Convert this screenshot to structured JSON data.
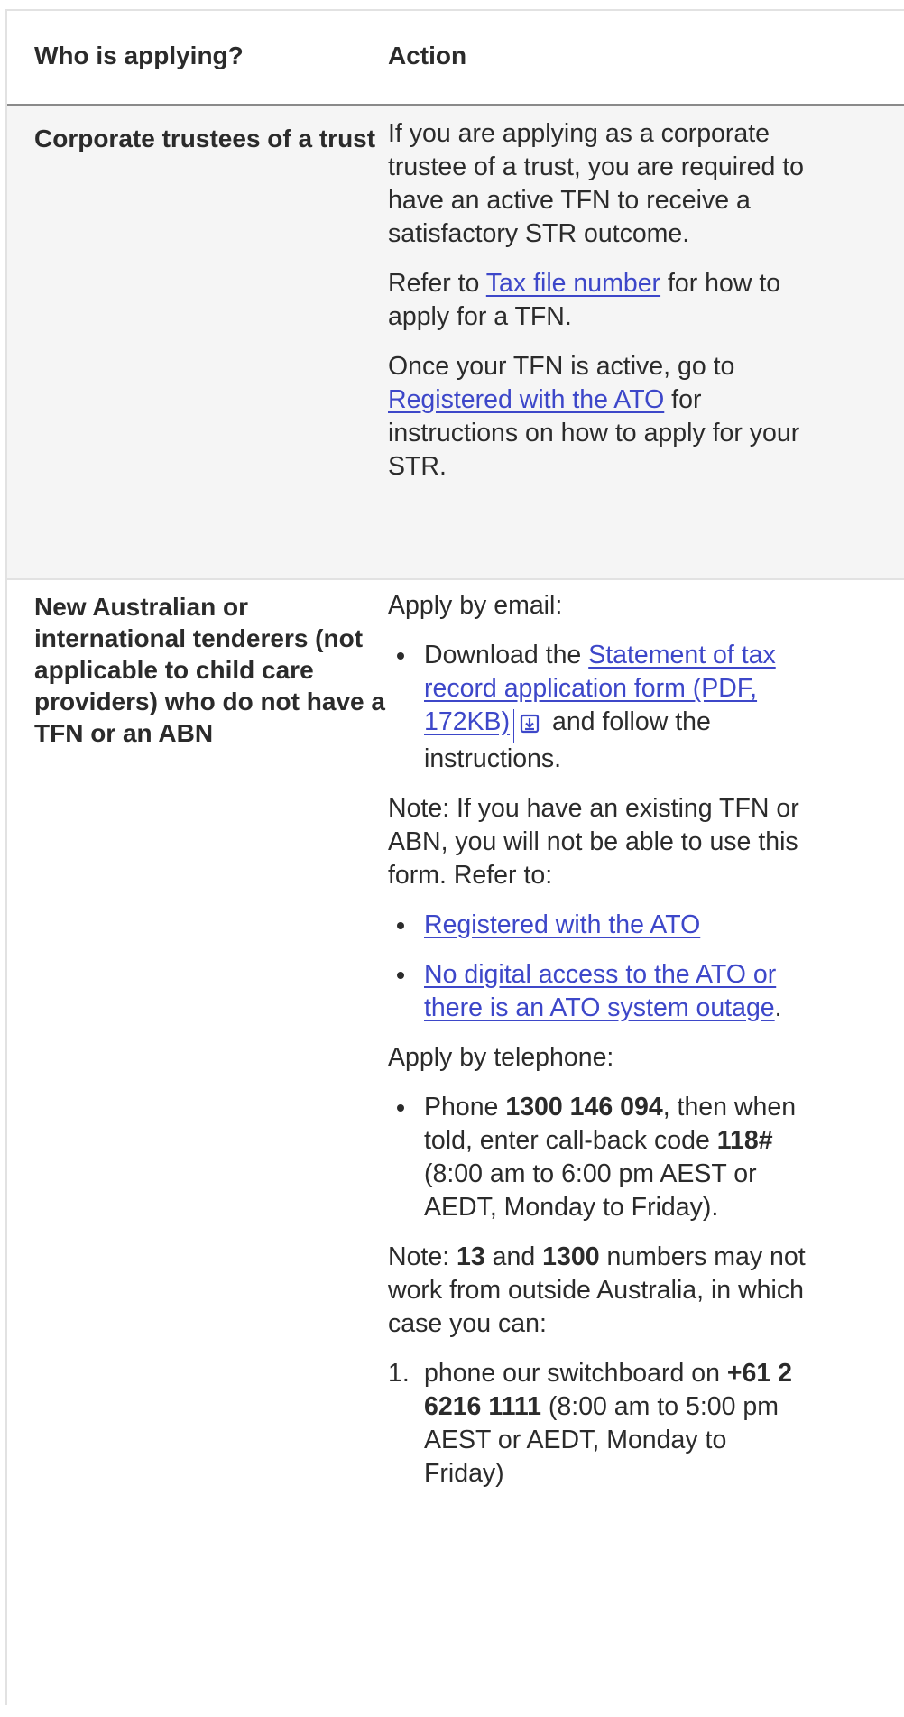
{
  "table": {
    "header": {
      "col1": "Who is applying?",
      "col2": "Action"
    },
    "row1": {
      "who": "Corporate trustees of a trust",
      "p1": "If you are applying as a corporate trustee of a trust, you are required to have an active TFN to receive a satisfactory STR outcome.",
      "p2_prefix": "Refer to ",
      "p2_link": "Tax file number",
      "p2_suffix": " for how to apply for a TFN.",
      "p3_prefix": "Once your TFN is active, go to ",
      "p3_link": "Registered with the ATO",
      "p3_suffix": " for instructions on how to apply for your STR."
    },
    "row2": {
      "who": "New Australian or international tenderers (not applicable to child care providers) who do not have a TFN or an ABN",
      "email_heading": "Apply by email:",
      "download_prefix": "Download the ",
      "download_link": "Statement of tax record application form (PDF, 172KB)",
      "download_suffix": " and follow the instructions.",
      "note1": "Note: If you have an existing TFN or ABN, you will not be able to use this form. Refer to:",
      "refer_link1": "Registered with the ATO",
      "refer_link2": "No digital access to the ATO or there is an ATO system outage",
      "refer_link2_suffix": ".",
      "phone_heading": "Apply by telephone:",
      "phone_prefix": "Phone ",
      "phone_number": "1300 146 094",
      "phone_mid": ", then when told, enter call-back code ",
      "phone_code": "118#",
      "phone_suffix": " (8:00 am to 6:00 pm AEST or AEDT, Monday to Friday).",
      "note2_prefix": "Note: ",
      "note2_b1": "13",
      "note2_mid": " and ",
      "note2_b2": "1300",
      "note2_suffix": " numbers may not work from outside Australia, in which case you can:",
      "ol_num": "1.",
      "ol_prefix": "phone our switchboard on ",
      "ol_number": "+61 2 6216 1111",
      "ol_suffix": " (8:00 am to 5:00 pm AEST or AEDT, Monday to Friday)"
    },
    "icons": {
      "download": "download-icon",
      "bullet": "bullet-icon"
    },
    "colors": {
      "link": "#3d47c9",
      "row_shade": "#f5f5f5",
      "border": "#e2e2e2",
      "header_rule": "#8a8a8a"
    }
  }
}
